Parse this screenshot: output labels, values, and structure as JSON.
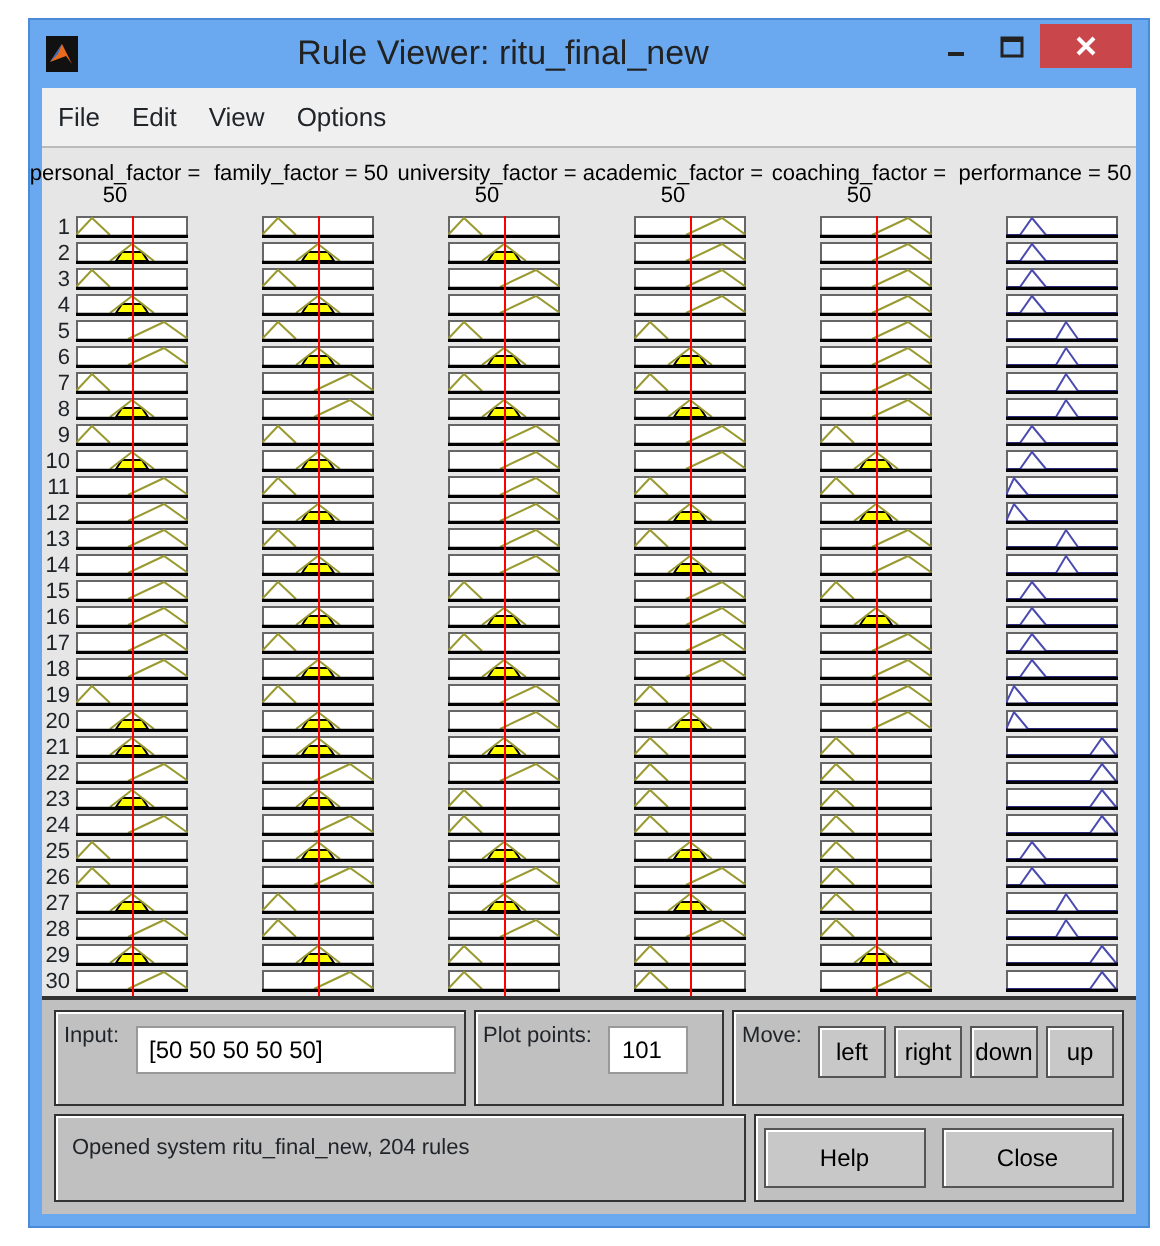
{
  "window": {
    "title": "Rule Viewer: ritu_final_new"
  },
  "menu": [
    "File",
    "Edit",
    "View",
    "Options"
  ],
  "variables": [
    {
      "label": "personal_factor = 50",
      "kind": "input"
    },
    {
      "label": "family_factor = 50",
      "kind": "input"
    },
    {
      "label": "university_factor = 50",
      "kind": "input"
    },
    {
      "label": "academic_factor = 50",
      "kind": "input"
    },
    {
      "label": "coaching_factor = 50",
      "kind": "input"
    },
    {
      "label": "performance = 50",
      "kind": "output"
    }
  ],
  "rules": [
    {
      "number": "1",
      "mfs": [
        {
          "kind": "low"
        },
        {
          "kind": "low"
        },
        {
          "kind": "low"
        },
        {
          "kind": "high"
        },
        {
          "kind": "high"
        },
        {
          "kind": "low"
        }
      ]
    },
    {
      "number": "2",
      "mfs": [
        {
          "kind": "mid"
        },
        {
          "kind": "mid"
        },
        {
          "kind": "mid"
        },
        {
          "kind": "high"
        },
        {
          "kind": "high"
        },
        {
          "kind": "low"
        }
      ]
    },
    {
      "number": "3",
      "mfs": [
        {
          "kind": "low"
        },
        {
          "kind": "low"
        },
        {
          "kind": "high"
        },
        {
          "kind": "high"
        },
        {
          "kind": "high"
        },
        {
          "kind": "low"
        }
      ]
    },
    {
      "number": "4",
      "mfs": [
        {
          "kind": "mid"
        },
        {
          "kind": "mid"
        },
        {
          "kind": "high"
        },
        {
          "kind": "high"
        },
        {
          "kind": "high"
        },
        {
          "kind": "low"
        }
      ]
    },
    {
      "number": "5",
      "mfs": [
        {
          "kind": "high"
        },
        {
          "kind": "low"
        },
        {
          "kind": "low"
        },
        {
          "kind": "low"
        },
        {
          "kind": "high"
        },
        {
          "kind": "mid"
        }
      ]
    },
    {
      "number": "6",
      "mfs": [
        {
          "kind": "high"
        },
        {
          "kind": "mid"
        },
        {
          "kind": "mid"
        },
        {
          "kind": "mid"
        },
        {
          "kind": "high"
        },
        {
          "kind": "mid"
        }
      ]
    },
    {
      "number": "7",
      "mfs": [
        {
          "kind": "low"
        },
        {
          "kind": "high"
        },
        {
          "kind": "low"
        },
        {
          "kind": "low"
        },
        {
          "kind": "high"
        },
        {
          "kind": "mid"
        }
      ]
    },
    {
      "number": "8",
      "mfs": [
        {
          "kind": "mid"
        },
        {
          "kind": "high"
        },
        {
          "kind": "mid"
        },
        {
          "kind": "mid"
        },
        {
          "kind": "high"
        },
        {
          "kind": "mid"
        }
      ]
    },
    {
      "number": "9",
      "mfs": [
        {
          "kind": "low"
        },
        {
          "kind": "low"
        },
        {
          "kind": "high"
        },
        {
          "kind": "high"
        },
        {
          "kind": "low"
        },
        {
          "kind": "low"
        }
      ]
    },
    {
      "number": "10",
      "mfs": [
        {
          "kind": "mid"
        },
        {
          "kind": "mid"
        },
        {
          "kind": "high"
        },
        {
          "kind": "high"
        },
        {
          "kind": "mid"
        },
        {
          "kind": "low"
        }
      ]
    },
    {
      "number": "11",
      "mfs": [
        {
          "kind": "high"
        },
        {
          "kind": "low"
        },
        {
          "kind": "high"
        },
        {
          "kind": "low"
        },
        {
          "kind": "low"
        },
        {
          "kind": "vlow"
        }
      ]
    },
    {
      "number": "12",
      "mfs": [
        {
          "kind": "high"
        },
        {
          "kind": "mid"
        },
        {
          "kind": "high"
        },
        {
          "kind": "mid"
        },
        {
          "kind": "mid"
        },
        {
          "kind": "vlow"
        }
      ]
    },
    {
      "number": "13",
      "mfs": [
        {
          "kind": "high"
        },
        {
          "kind": "low"
        },
        {
          "kind": "high"
        },
        {
          "kind": "low"
        },
        {
          "kind": "high"
        },
        {
          "kind": "mid"
        }
      ]
    },
    {
      "number": "14",
      "mfs": [
        {
          "kind": "high"
        },
        {
          "kind": "mid"
        },
        {
          "kind": "high"
        },
        {
          "kind": "mid"
        },
        {
          "kind": "high"
        },
        {
          "kind": "mid"
        }
      ]
    },
    {
      "number": "15",
      "mfs": [
        {
          "kind": "high"
        },
        {
          "kind": "low"
        },
        {
          "kind": "low"
        },
        {
          "kind": "high"
        },
        {
          "kind": "low"
        },
        {
          "kind": "low"
        }
      ]
    },
    {
      "number": "16",
      "mfs": [
        {
          "kind": "high"
        },
        {
          "kind": "mid"
        },
        {
          "kind": "mid"
        },
        {
          "kind": "high"
        },
        {
          "kind": "mid"
        },
        {
          "kind": "low"
        }
      ]
    },
    {
      "number": "17",
      "mfs": [
        {
          "kind": "high"
        },
        {
          "kind": "low"
        },
        {
          "kind": "low"
        },
        {
          "kind": "high"
        },
        {
          "kind": "high"
        },
        {
          "kind": "low"
        }
      ]
    },
    {
      "number": "18",
      "mfs": [
        {
          "kind": "high"
        },
        {
          "kind": "mid"
        },
        {
          "kind": "mid"
        },
        {
          "kind": "high"
        },
        {
          "kind": "high"
        },
        {
          "kind": "low"
        }
      ]
    },
    {
      "number": "19",
      "mfs": [
        {
          "kind": "low"
        },
        {
          "kind": "low"
        },
        {
          "kind": "high"
        },
        {
          "kind": "low"
        },
        {
          "kind": "high"
        },
        {
          "kind": "vlow"
        }
      ]
    },
    {
      "number": "20",
      "mfs": [
        {
          "kind": "mid"
        },
        {
          "kind": "mid"
        },
        {
          "kind": "high"
        },
        {
          "kind": "mid"
        },
        {
          "kind": "high"
        },
        {
          "kind": "vlow"
        }
      ]
    },
    {
      "number": "21",
      "mfs": [
        {
          "kind": "mid"
        },
        {
          "kind": "mid"
        },
        {
          "kind": "mid"
        },
        {
          "kind": "low"
        },
        {
          "kind": "low"
        },
        {
          "kind": "high"
        }
      ]
    },
    {
      "number": "22",
      "mfs": [
        {
          "kind": "high"
        },
        {
          "kind": "high"
        },
        {
          "kind": "high"
        },
        {
          "kind": "low"
        },
        {
          "kind": "low"
        },
        {
          "kind": "high"
        }
      ]
    },
    {
      "number": "23",
      "mfs": [
        {
          "kind": "mid"
        },
        {
          "kind": "mid"
        },
        {
          "kind": "low"
        },
        {
          "kind": "low"
        },
        {
          "kind": "low"
        },
        {
          "kind": "high"
        }
      ]
    },
    {
      "number": "24",
      "mfs": [
        {
          "kind": "high"
        },
        {
          "kind": "high"
        },
        {
          "kind": "low"
        },
        {
          "kind": "low"
        },
        {
          "kind": "low"
        },
        {
          "kind": "high"
        }
      ]
    },
    {
      "number": "25",
      "mfs": [
        {
          "kind": "low"
        },
        {
          "kind": "mid"
        },
        {
          "kind": "mid"
        },
        {
          "kind": "mid"
        },
        {
          "kind": "low"
        },
        {
          "kind": "low"
        }
      ]
    },
    {
      "number": "26",
      "mfs": [
        {
          "kind": "low"
        },
        {
          "kind": "high"
        },
        {
          "kind": "high"
        },
        {
          "kind": "high"
        },
        {
          "kind": "low"
        },
        {
          "kind": "low"
        }
      ]
    },
    {
      "number": "27",
      "mfs": [
        {
          "kind": "mid"
        },
        {
          "kind": "low"
        },
        {
          "kind": "mid"
        },
        {
          "kind": "mid"
        },
        {
          "kind": "low"
        },
        {
          "kind": "mid"
        }
      ]
    },
    {
      "number": "28",
      "mfs": [
        {
          "kind": "high"
        },
        {
          "kind": "low"
        },
        {
          "kind": "high"
        },
        {
          "kind": "high"
        },
        {
          "kind": "low"
        },
        {
          "kind": "mid"
        }
      ]
    },
    {
      "number": "29",
      "mfs": [
        {
          "kind": "mid"
        },
        {
          "kind": "mid"
        },
        {
          "kind": "low"
        },
        {
          "kind": "low"
        },
        {
          "kind": "mid"
        },
        {
          "kind": "high"
        }
      ]
    },
    {
      "number": "30",
      "mfs": [
        {
          "kind": "high"
        },
        {
          "kind": "high"
        },
        {
          "kind": "low"
        },
        {
          "kind": "low"
        },
        {
          "kind": "high"
        },
        {
          "kind": "high"
        }
      ]
    }
  ],
  "input": {
    "label": "Input:",
    "value": "[50 50 50 50 50]"
  },
  "plot_points": {
    "label": "Plot points:",
    "value": "101"
  },
  "move": {
    "label": "Move:",
    "buttons": [
      "left",
      "right",
      "down",
      "up"
    ]
  },
  "status": "Opened system ritu_final_new, 204 rules",
  "buttons": [
    "Help",
    "Close"
  ]
}
